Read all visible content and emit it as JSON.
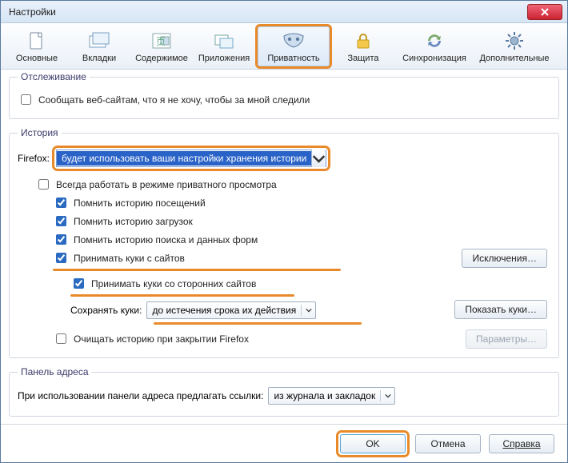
{
  "window": {
    "title": "Настройки"
  },
  "toolbar": {
    "main": "Основные",
    "tabs": "Вкладки",
    "content": "Содержимое",
    "apps": "Приложения",
    "privacy": "Приватность",
    "security": "Защита",
    "sync": "Синхронизация",
    "advanced": "Дополнительные"
  },
  "tracking": {
    "legend": "Отслеживание",
    "dnt": "Сообщать веб-сайтам, что я не хочу, чтобы за мной следили"
  },
  "history": {
    "legend": "История",
    "firefox_label": "Firefox:",
    "mode": "будет использовать ваши настройки хранения истории",
    "always_private": "Всегда работать в режиме приватного просмотра",
    "remember_browsing": "Помнить историю посещений",
    "remember_downloads": "Помнить историю загрузок",
    "remember_search": "Помнить историю поиска и данных форм",
    "accept_cookies": "Принимать куки с сайтов",
    "exceptions_btn": "Исключения…",
    "accept_third": "Принимать куки со сторонних сайтов",
    "keep_label": "Сохранять куки:",
    "keep_value": "до истечения срока их действия",
    "show_cookies_btn": "Показать куки…",
    "clear_on_close": "Очищать историю при закрытии Firefox",
    "settings_btn": "Параметры…"
  },
  "locationbar": {
    "legend": "Панель адреса",
    "label": "При использовании панели адреса предлагать ссылки:",
    "value": "из журнала и закладок"
  },
  "footer": {
    "ok": "OK",
    "cancel": "Отмена",
    "help": "Справка"
  }
}
